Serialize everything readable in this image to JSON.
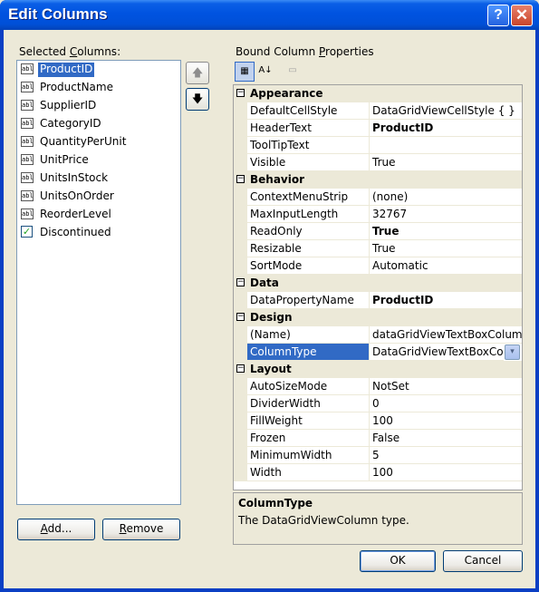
{
  "window": {
    "title": "Edit Columns",
    "help_glyph": "?",
    "close_glyph": "✕"
  },
  "left": {
    "label_prefix": "Selected ",
    "label_accel": "C",
    "label_suffix": "olumns:",
    "columns": [
      {
        "name": "ProductID",
        "icon": "textbox-column-icon",
        "icon_text": "abl",
        "selected": true
      },
      {
        "name": "ProductName",
        "icon": "textbox-column-icon",
        "icon_text": "abl"
      },
      {
        "name": "SupplierID",
        "icon": "textbox-column-icon",
        "icon_text": "abl"
      },
      {
        "name": "CategoryID",
        "icon": "textbox-column-icon",
        "icon_text": "abl"
      },
      {
        "name": "QuantityPerUnit",
        "icon": "textbox-column-icon",
        "icon_text": "abl"
      },
      {
        "name": "UnitPrice",
        "icon": "textbox-column-icon",
        "icon_text": "abl"
      },
      {
        "name": "UnitsInStock",
        "icon": "textbox-column-icon",
        "icon_text": "abl"
      },
      {
        "name": "UnitsOnOrder",
        "icon": "textbox-column-icon",
        "icon_text": "abl"
      },
      {
        "name": "ReorderLevel",
        "icon": "textbox-column-icon",
        "icon_text": "abl"
      },
      {
        "name": "Discontinued",
        "icon": "checkbox-column-icon",
        "icon_text": "✓"
      }
    ],
    "move_up_glyph": "🡅",
    "move_down_glyph": "🡇",
    "add_label_accel": "A",
    "add_label_rest": "dd...",
    "remove_label_accel": "R",
    "remove_label_rest": "emove"
  },
  "right": {
    "label_prefix": "Bound Column ",
    "label_accel": "P",
    "label_suffix": "roperties",
    "toolbar": {
      "categorized_glyph": "▦",
      "alphabetical_glyph": "A↓",
      "property_pages_glyph": "▭"
    },
    "grid": [
      {
        "category": "Appearance",
        "toggle": "−",
        "props": [
          {
            "name": "DefaultCellStyle",
            "value": "DataGridViewCellStyle { }"
          },
          {
            "name": "HeaderText",
            "value": "ProductID",
            "bold": true
          },
          {
            "name": "ToolTipText",
            "value": ""
          },
          {
            "name": "Visible",
            "value": "True"
          }
        ]
      },
      {
        "category": "Behavior",
        "toggle": "−",
        "props": [
          {
            "name": "ContextMenuStrip",
            "value": "(none)"
          },
          {
            "name": "MaxInputLength",
            "value": "32767"
          },
          {
            "name": "ReadOnly",
            "value": "True",
            "bold": true
          },
          {
            "name": "Resizable",
            "value": "True"
          },
          {
            "name": "SortMode",
            "value": "Automatic"
          }
        ]
      },
      {
        "category": "Data",
        "toggle": "−",
        "props": [
          {
            "name": "DataPropertyName",
            "value": "ProductID",
            "bold": true
          }
        ]
      },
      {
        "category": "Design",
        "toggle": "−",
        "props": [
          {
            "name": "(Name)",
            "value": "dataGridViewTextBoxColumn"
          },
          {
            "name": "ColumnType",
            "value": "DataGridViewTextBoxColumn",
            "selected": true,
            "dropdown": "▾"
          }
        ]
      },
      {
        "category": "Layout",
        "toggle": "−",
        "props": [
          {
            "name": "AutoSizeMode",
            "value": "NotSet"
          },
          {
            "name": "DividerWidth",
            "value": "0"
          },
          {
            "name": "FillWeight",
            "value": "100"
          },
          {
            "name": "Frozen",
            "value": "False"
          },
          {
            "name": "MinimumWidth",
            "value": "5"
          },
          {
            "name": "Width",
            "value": "100"
          }
        ]
      }
    ],
    "description": {
      "title": "ColumnType",
      "text": "The DataGridViewColumn type."
    }
  },
  "footer": {
    "ok_label": "OK",
    "cancel_label": "Cancel"
  },
  "colors": {
    "selection": "#316ac5",
    "titlebar": "#0053e0",
    "dialog_bg": "#ece9d8"
  }
}
